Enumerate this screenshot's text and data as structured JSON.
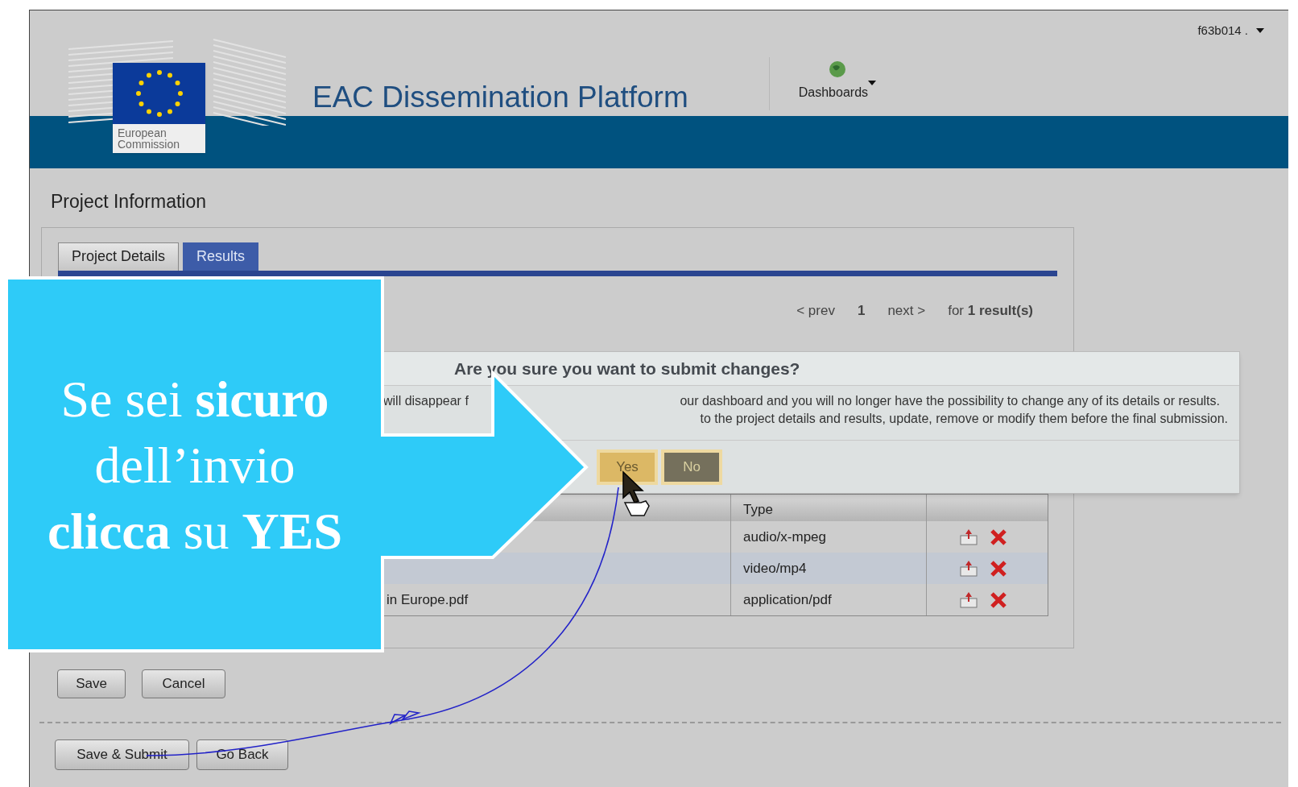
{
  "header": {
    "user_menu": "f63b014 .",
    "logo_caption": "European Commission",
    "title": "EAC Dissemination Platform",
    "dashboards": "Dashboards"
  },
  "page_title": "Project Information",
  "tabs": [
    {
      "label": "Project Details",
      "selected": false
    },
    {
      "label": "Results",
      "selected": true
    }
  ],
  "pagination": {
    "prev": "< prev",
    "page": "1",
    "next": "next >",
    "summary": "for **1 result(s)**"
  },
  "files_table": {
    "type_header": "Type",
    "rows": [
      {
        "type": "audio/x-mpeg"
      },
      {
        "type": "video/mp4"
      },
      {
        "name": "in Europe.pdf",
        "type": "application/pdf"
      }
    ]
  },
  "form_buttons": [
    "Save",
    "Cancel"
  ],
  "submit_buttons": [
    "Save & Submit",
    "Go Back"
  ],
  "dialog": {
    "title": "Are you sure you want to submit changes?",
    "line_1": [
      "will disappear f",
      "our dashboard and you will no longer have the possibility to change any of its details or results."
    ],
    "line_2": "to the project details and results, update, remove or modify them before the final submission.",
    "buttons": [
      {
        "label": "Yes",
        "selected": true
      },
      {
        "label": "No",
        "selected": false
      }
    ]
  },
  "callout": {
    "text": "Se sei **sicuro** dell’invio **clicca** su **YES**"
  }
}
